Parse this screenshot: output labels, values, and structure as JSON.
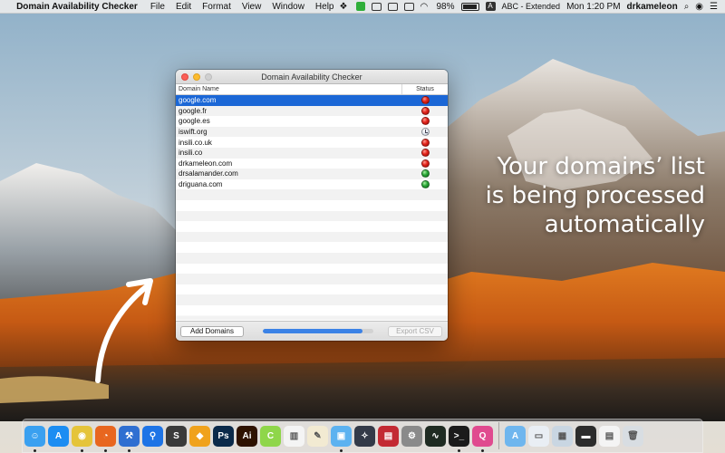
{
  "menubar": {
    "app_name": "Domain Availability Checker",
    "menus": [
      "File",
      "Edit",
      "Format",
      "View",
      "Window",
      "Help"
    ],
    "battery": "98%",
    "input_source": "ABC - Extended",
    "clock": "Mon 1:20 PM",
    "user": "drkameleon"
  },
  "window": {
    "title": "Domain Availability Checker",
    "columns": {
      "domain": "Domain Name",
      "status": "Status"
    },
    "rows": [
      {
        "domain": "google.com",
        "status": "red"
      },
      {
        "domain": "google.fr",
        "status": "red"
      },
      {
        "domain": "google.es",
        "status": "red"
      },
      {
        "domain": "iswift.org",
        "status": "pending"
      },
      {
        "domain": "insili.co.uk",
        "status": "red"
      },
      {
        "domain": "insili.co",
        "status": "red"
      },
      {
        "domain": "drkameleon.com",
        "status": "red"
      },
      {
        "domain": "drsalamander.com",
        "status": "green"
      },
      {
        "domain": "driguana.com",
        "status": "green"
      }
    ],
    "selected_row": 0,
    "add_button": "Add Domains",
    "export_button": "Export CSV",
    "progress": 0.9
  },
  "caption": {
    "lines": [
      "Your domains’ list",
      "is being processed",
      "automatically"
    ]
  },
  "colors": {
    "selection": "#1b67d6",
    "status_red": "#e2231a",
    "status_green": "#2aa838",
    "progress": "#3b82e6"
  },
  "dock": {
    "apps": [
      {
        "name": "finder-icon",
        "color": "#3aa0f0",
        "glyph": "☺",
        "running": true
      },
      {
        "name": "app-store-icon",
        "color": "#1c8df2",
        "glyph": "A",
        "running": false
      },
      {
        "name": "chrome-icon",
        "color": "#e5c43a",
        "glyph": "◉",
        "running": true
      },
      {
        "name": "firefox-icon",
        "color": "#e8661f",
        "glyph": "◔",
        "running": true
      },
      {
        "name": "xcode-icon",
        "color": "#2f6fd1",
        "glyph": "⚒",
        "running": true
      },
      {
        "name": "maps-icon",
        "color": "#1e74e6",
        "glyph": "⚲",
        "running": false
      },
      {
        "name": "sublime-icon",
        "color": "#3a3a3a",
        "glyph": "S",
        "running": false
      },
      {
        "name": "sketch-icon",
        "color": "#f0a21c",
        "glyph": "◆",
        "running": false
      },
      {
        "name": "photoshop-icon",
        "color": "#0b2a4a",
        "glyph": "Ps",
        "running": false
      },
      {
        "name": "illustrator-icon",
        "color": "#2e1200",
        "glyph": "Ai",
        "running": false
      },
      {
        "name": "codekit-icon",
        "color": "#8fd64a",
        "glyph": "C",
        "running": false
      },
      {
        "name": "numbers-icon",
        "color": "#f4f4f4",
        "glyph": "▥",
        "running": false
      },
      {
        "name": "textedit-icon",
        "color": "#f2ead2",
        "glyph": "✎",
        "running": false
      },
      {
        "name": "preview-icon",
        "color": "#5cb2f0",
        "glyph": "▣",
        "running": true
      },
      {
        "name": "safari-icon",
        "color": "#333a48",
        "glyph": "✧",
        "running": false
      },
      {
        "name": "parallels-icon",
        "color": "#c32a33",
        "glyph": "▤",
        "running": false
      },
      {
        "name": "system-prefs-icon",
        "color": "#8a8a8a",
        "glyph": "⚙",
        "running": false
      },
      {
        "name": "activity-monitor-icon",
        "color": "#1f2b22",
        "glyph": "∿",
        "running": false
      },
      {
        "name": "terminal-icon",
        "color": "#1b1b1b",
        "glyph": ">_",
        "running": true
      },
      {
        "name": "domain-checker-icon",
        "color": "#e04a8f",
        "glyph": "Q",
        "running": true
      }
    ],
    "docs": [
      {
        "name": "applications-folder-icon",
        "color": "#6fb6ee",
        "glyph": "A"
      },
      {
        "name": "document-thumb-icon",
        "color": "#e9eef4",
        "glyph": "▭"
      },
      {
        "name": "screenshot-thumb-icon",
        "color": "#c9d6e2",
        "glyph": "▦"
      },
      {
        "name": "terminal-thumb-icon",
        "color": "#2c2c2c",
        "glyph": "▬"
      },
      {
        "name": "document-thumb-icon-2",
        "color": "#f4f4f4",
        "glyph": "▤"
      },
      {
        "name": "trash-icon",
        "color": "#d8dde2",
        "glyph": "🗑"
      }
    ]
  }
}
